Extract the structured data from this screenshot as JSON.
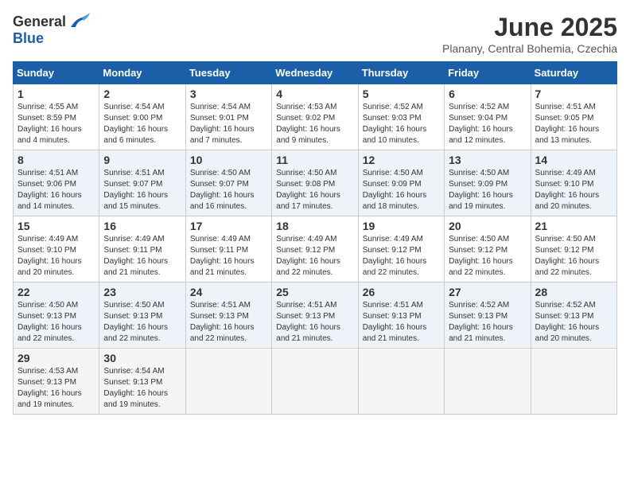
{
  "header": {
    "logo_general": "General",
    "logo_blue": "Blue",
    "month": "June 2025",
    "location": "Planany, Central Bohemia, Czechia"
  },
  "days_of_week": [
    "Sunday",
    "Monday",
    "Tuesday",
    "Wednesday",
    "Thursday",
    "Friday",
    "Saturday"
  ],
  "weeks": [
    [
      {
        "day": "1",
        "sunrise": "4:55 AM",
        "sunset": "8:59 PM",
        "daylight": "16 hours and 4 minutes."
      },
      {
        "day": "2",
        "sunrise": "4:54 AM",
        "sunset": "9:00 PM",
        "daylight": "16 hours and 6 minutes."
      },
      {
        "day": "3",
        "sunrise": "4:54 AM",
        "sunset": "9:01 PM",
        "daylight": "16 hours and 7 minutes."
      },
      {
        "day": "4",
        "sunrise": "4:53 AM",
        "sunset": "9:02 PM",
        "daylight": "16 hours and 9 minutes."
      },
      {
        "day": "5",
        "sunrise": "4:52 AM",
        "sunset": "9:03 PM",
        "daylight": "16 hours and 10 minutes."
      },
      {
        "day": "6",
        "sunrise": "4:52 AM",
        "sunset": "9:04 PM",
        "daylight": "16 hours and 12 minutes."
      },
      {
        "day": "7",
        "sunrise": "4:51 AM",
        "sunset": "9:05 PM",
        "daylight": "16 hours and 13 minutes."
      }
    ],
    [
      {
        "day": "8",
        "sunrise": "4:51 AM",
        "sunset": "9:06 PM",
        "daylight": "16 hours and 14 minutes."
      },
      {
        "day": "9",
        "sunrise": "4:51 AM",
        "sunset": "9:07 PM",
        "daylight": "16 hours and 15 minutes."
      },
      {
        "day": "10",
        "sunrise": "4:50 AM",
        "sunset": "9:07 PM",
        "daylight": "16 hours and 16 minutes."
      },
      {
        "day": "11",
        "sunrise": "4:50 AM",
        "sunset": "9:08 PM",
        "daylight": "16 hours and 17 minutes."
      },
      {
        "day": "12",
        "sunrise": "4:50 AM",
        "sunset": "9:09 PM",
        "daylight": "16 hours and 18 minutes."
      },
      {
        "day": "13",
        "sunrise": "4:50 AM",
        "sunset": "9:09 PM",
        "daylight": "16 hours and 19 minutes."
      },
      {
        "day": "14",
        "sunrise": "4:49 AM",
        "sunset": "9:10 PM",
        "daylight": "16 hours and 20 minutes."
      }
    ],
    [
      {
        "day": "15",
        "sunrise": "4:49 AM",
        "sunset": "9:10 PM",
        "daylight": "16 hours and 20 minutes."
      },
      {
        "day": "16",
        "sunrise": "4:49 AM",
        "sunset": "9:11 PM",
        "daylight": "16 hours and 21 minutes."
      },
      {
        "day": "17",
        "sunrise": "4:49 AM",
        "sunset": "9:11 PM",
        "daylight": "16 hours and 21 minutes."
      },
      {
        "day": "18",
        "sunrise": "4:49 AM",
        "sunset": "9:12 PM",
        "daylight": "16 hours and 22 minutes."
      },
      {
        "day": "19",
        "sunrise": "4:49 AM",
        "sunset": "9:12 PM",
        "daylight": "16 hours and 22 minutes."
      },
      {
        "day": "20",
        "sunrise": "4:50 AM",
        "sunset": "9:12 PM",
        "daylight": "16 hours and 22 minutes."
      },
      {
        "day": "21",
        "sunrise": "4:50 AM",
        "sunset": "9:12 PM",
        "daylight": "16 hours and 22 minutes."
      }
    ],
    [
      {
        "day": "22",
        "sunrise": "4:50 AM",
        "sunset": "9:13 PM",
        "daylight": "16 hours and 22 minutes."
      },
      {
        "day": "23",
        "sunrise": "4:50 AM",
        "sunset": "9:13 PM",
        "daylight": "16 hours and 22 minutes."
      },
      {
        "day": "24",
        "sunrise": "4:51 AM",
        "sunset": "9:13 PM",
        "daylight": "16 hours and 22 minutes."
      },
      {
        "day": "25",
        "sunrise": "4:51 AM",
        "sunset": "9:13 PM",
        "daylight": "16 hours and 21 minutes."
      },
      {
        "day": "26",
        "sunrise": "4:51 AM",
        "sunset": "9:13 PM",
        "daylight": "16 hours and 21 minutes."
      },
      {
        "day": "27",
        "sunrise": "4:52 AM",
        "sunset": "9:13 PM",
        "daylight": "16 hours and 21 minutes."
      },
      {
        "day": "28",
        "sunrise": "4:52 AM",
        "sunset": "9:13 PM",
        "daylight": "16 hours and 20 minutes."
      }
    ],
    [
      {
        "day": "29",
        "sunrise": "4:53 AM",
        "sunset": "9:13 PM",
        "daylight": "16 hours and 19 minutes."
      },
      {
        "day": "30",
        "sunrise": "4:54 AM",
        "sunset": "9:13 PM",
        "daylight": "16 hours and 19 minutes."
      },
      null,
      null,
      null,
      null,
      null
    ]
  ],
  "labels": {
    "sunrise": "Sunrise:",
    "sunset": "Sunset:",
    "daylight": "Daylight:"
  }
}
